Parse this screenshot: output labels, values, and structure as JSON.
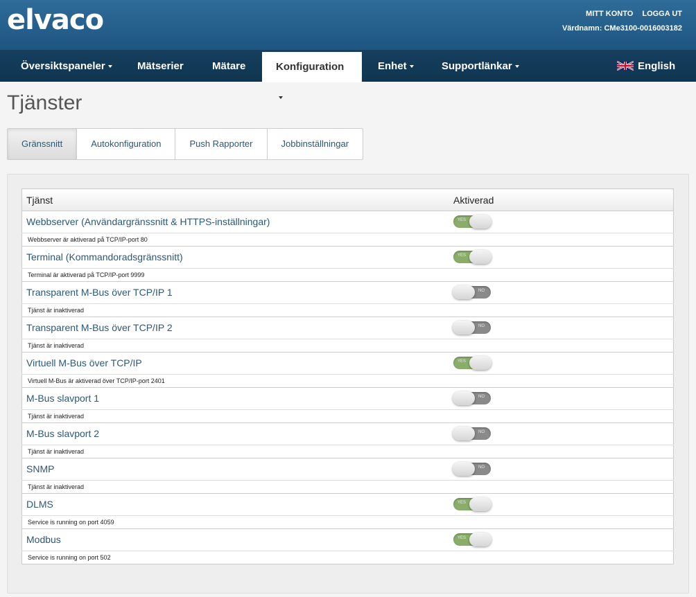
{
  "header": {
    "logo": "elvaco",
    "links": [
      "MITT KONTO",
      "LOGGA UT"
    ],
    "hostname": "Värdnamn: CMe3100-0016003182"
  },
  "nav": {
    "items": [
      {
        "label": "Översiktspaneler",
        "dropdown": true
      },
      {
        "label": "Mätserier",
        "dropdown": false
      },
      {
        "label": "Mätare",
        "dropdown": false
      },
      {
        "label": "Konfiguration",
        "dropdown": true
      },
      {
        "label": "Enhet",
        "dropdown": true
      },
      {
        "label": "Supportlänkar",
        "dropdown": true
      }
    ],
    "active": "Konfiguration",
    "language": "English",
    "language_icon": "uk-flag-icon"
  },
  "page": {
    "title": "Tjänster",
    "tabs": [
      "Gränssnitt",
      "Autokonfiguration",
      "Push Rapporter",
      "Jobbinställningar"
    ],
    "active_tab": "Gränssnitt"
  },
  "table": {
    "headers": [
      "Tjänst",
      "Aktiverad"
    ],
    "rows": [
      {
        "name": "Webbserver (Användargränssnitt & HTTPS-inställningar)",
        "enabled": true,
        "description": "Webbserver är aktiverad på TCP/IP-port 80"
      },
      {
        "name": "Terminal (Kommandoradsgränssnitt)",
        "enabled": true,
        "description": "Terminal är aktiverad på TCP/IP-port 9999"
      },
      {
        "name": "Transparent M-Bus över TCP/IP 1",
        "enabled": false,
        "description": "Tjänst är inaktiverad"
      },
      {
        "name": "Transparent M-Bus över TCP/IP 2",
        "enabled": false,
        "description": "Tjänst är inaktiverad"
      },
      {
        "name": "Virtuell M-Bus över TCP/IP",
        "enabled": true,
        "description": "Virtuell M-Bus är aktiverad över TCP/IP-port 2401"
      },
      {
        "name": "M-Bus slavport 1",
        "enabled": false,
        "description": "Tjänst är inaktiverad"
      },
      {
        "name": "M-Bus slavport 2",
        "enabled": false,
        "description": "Tjänst är inaktiverad"
      },
      {
        "name": "SNMP",
        "enabled": false,
        "description": "Tjänst är inaktiverad"
      },
      {
        "name": "DLMS",
        "enabled": true,
        "description": "Service is running on port 4059"
      },
      {
        "name": "Modbus",
        "enabled": true,
        "description": "Service is running on port 502"
      }
    ],
    "toggle_labels": {
      "on": "YES",
      "off": "NO"
    }
  },
  "colors": {
    "header_blue": "#2f6c9a",
    "nav_dark": "#0f3550",
    "link_blue": "#2a5878",
    "toggle_on": "#8aae6a",
    "toggle_off": "#8a8a8a"
  }
}
